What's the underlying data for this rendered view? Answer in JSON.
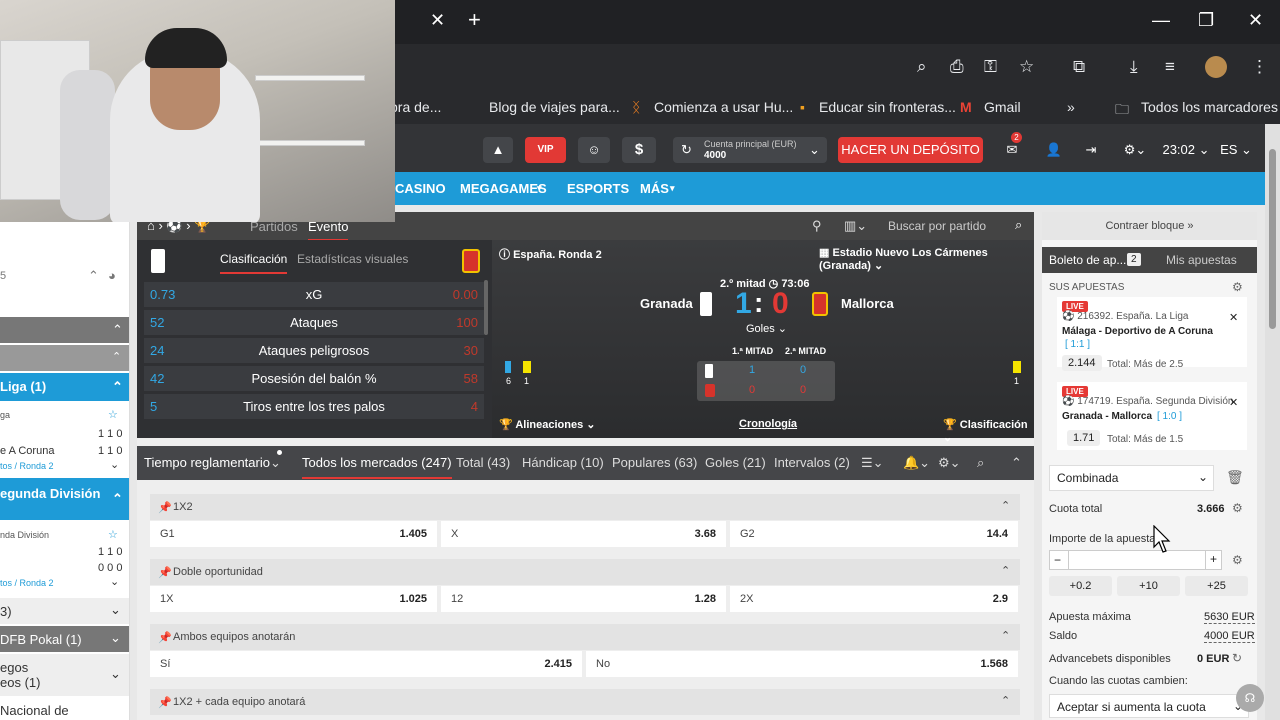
{
  "browser": {
    "close_tab": "✕",
    "new_tab": "+",
    "win_min": "—",
    "win_max": "❐",
    "win_close": "✕",
    "bookmarks": [
      "pra de...",
      "Blog de viajes para...",
      "Comienza a usar Hu...",
      "Educar sin fronteras...",
      "Gmail",
      "»",
      "Todos los marcadores"
    ]
  },
  "header": {
    "vip": "VIP",
    "account_label": "Cuenta principal (EUR)",
    "account_value": "4000",
    "deposit": "HACER UN DEPÓSITO",
    "mail_badge": "2",
    "time": "23:02",
    "lang": "ES"
  },
  "nav": [
    "CASINO",
    "MEGAGAMES",
    "ESPORTS",
    "MÁS"
  ],
  "sidebar": {
    "rows": [
      "5",
      "",
      "",
      "Liga (1)",
      "ga",
      "e A Coruna",
      "tos / Ronda 2",
      "egunda División",
      "nda División",
      "",
      "tos / Ronda 2",
      "3)",
      "DFB Pokal (1)",
      "egos",
      "eos (1)",
      "Nacional de"
    ],
    "scores1": [
      "1 1 0",
      "1 1 0"
    ],
    "scores2": [
      "1 1 0",
      "0 0 0"
    ]
  },
  "event": {
    "tabs": [
      "Partidos",
      "Evento"
    ],
    "search_placeholder": "Buscar por partido",
    "stat_tabs": [
      "Clasificación",
      "Estadísticas visuales"
    ],
    "stats": [
      {
        "left": "0.73",
        "name": "xG",
        "right": "0.00"
      },
      {
        "left": "52",
        "name": "Ataques",
        "right": "100"
      },
      {
        "left": "24",
        "name": "Ataques peligrosos",
        "right": "30"
      },
      {
        "left": "42",
        "name": "Posesión del balón %",
        "right": "58"
      },
      {
        "left": "5",
        "name": "Tiros entre los tres palos",
        "right": "4"
      }
    ],
    "round": "España. Ronda 2",
    "stadium": "Estadio Nuevo Los Cármenes (Granada)",
    "half": "2.º mitad",
    "clock": "73:06",
    "home": "Granada",
    "away": "Mallorca",
    "score_home": "1",
    "score_sep": ":",
    "score_away": "0",
    "goles": "Goles",
    "h1_label": "1.ª MITAD",
    "h2_label": "2.ª MITAD",
    "h1_home": "1",
    "h2_home": "0",
    "h1_away": "0",
    "h2_away": "0",
    "corners_home": "6",
    "cards_home": "1",
    "cards_away": "1",
    "alineaciones": "Alineaciones",
    "cronologia": "Cronología",
    "clasificacion": "Clasificación"
  },
  "markets_bar": [
    "Tiempo reglamentario",
    "Todos los mercados (247)",
    "Total (43)",
    "Hándicap (10)",
    "Populares (63)",
    "Goles (21)",
    "Intervalos (2)"
  ],
  "markets": [
    {
      "title": "1X2",
      "odds": [
        [
          "G1",
          "1.405"
        ],
        [
          "X",
          "3.68"
        ],
        [
          "G2",
          "14.4"
        ]
      ]
    },
    {
      "title": "Doble oportunidad",
      "odds": [
        [
          "1X",
          "1.025"
        ],
        [
          "12",
          "1.28"
        ],
        [
          "2X",
          "2.9"
        ]
      ]
    },
    {
      "title": "Ambos equipos anotarán",
      "odds": [
        [
          "Sí",
          "2.415"
        ],
        [
          "No",
          "1.568"
        ]
      ]
    },
    {
      "title": "1X2 + cada equipo anotará",
      "odds": []
    }
  ],
  "slip": {
    "contraer": "Contraer bloque »",
    "tab_boleto": "Boleto de ap...",
    "tab_count": "2",
    "tab_mis": "Mis apuestas",
    "sus_apuestas": "SUS APUESTAS",
    "bets": [
      {
        "live": "LIVE",
        "league": "216392. España. La Liga",
        "match": "Málaga - Deportivo de A Coruna",
        "score": "[ 1:1 ]",
        "odd": "2.144",
        "market": "Total: Más de 2.5"
      },
      {
        "live": "LIVE",
        "league": "174719. España. Segunda División",
        "match": "Granada - Mallorca",
        "score": "[ 1:0 ]",
        "odd": "1.71",
        "market": "Total: Más de 1.5"
      }
    ],
    "type": "Combinada",
    "cuota_label": "Cuota total",
    "cuota_value": "3.666",
    "importe_label": "Importe de la apuesta",
    "quick": [
      "+0.2",
      "+10",
      "+25"
    ],
    "max_label": "Apuesta máxima",
    "max_value": "5630 EUR",
    "saldo_label": "Saldo",
    "saldo_value": "4000 EUR",
    "adv_label": "Advancebets disponibles",
    "adv_value": "0 EUR",
    "change_label": "Cuando las cuotas cambien:",
    "change_value": "Aceptar si aumenta la cuota"
  }
}
